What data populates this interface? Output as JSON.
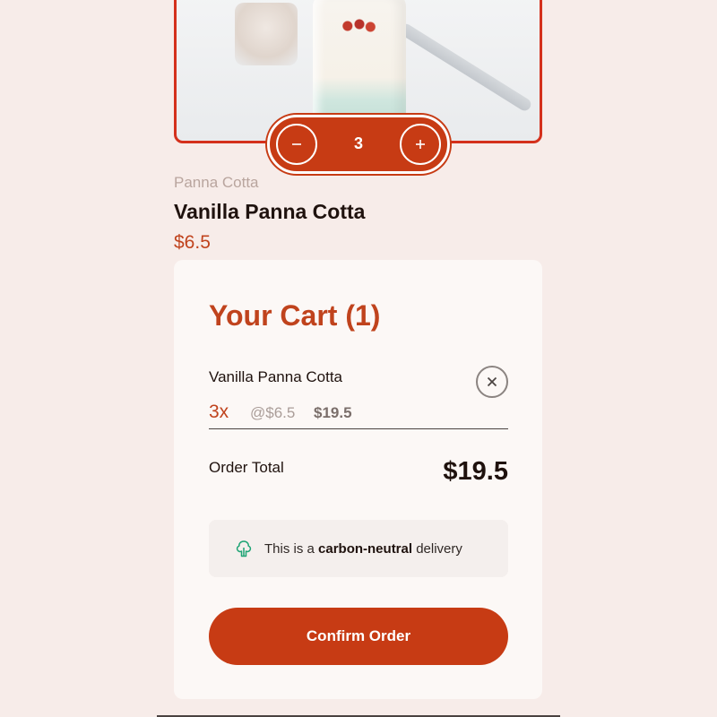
{
  "product": {
    "category": "Panna Cotta",
    "name": "Vanilla Panna Cotta",
    "price": "$6.5",
    "quantity": "3",
    "decrement_icon": "minus-icon",
    "increment_icon": "plus-icon"
  },
  "cart": {
    "title": "Your Cart (1)",
    "items": [
      {
        "name": "Vanilla Panna Cotta",
        "quantity": "3x",
        "unit_price": "@$6.5",
        "subtotal": "$19.5",
        "remove_icon": "close-circle-icon"
      }
    ],
    "order_total_label": "Order Total",
    "order_total_value": "$19.5",
    "carbon_notice": {
      "prefix": "This is a ",
      "highlight": "carbon-neutral",
      "suffix": " delivery",
      "icon": "tree-icon"
    },
    "confirm_label": "Confirm Order"
  },
  "colors": {
    "accent": "#c73b14",
    "background": "#f7ece9",
    "card": "#fcf8f6",
    "selected_border": "#d4301c",
    "eco_green": "#1ea475"
  }
}
